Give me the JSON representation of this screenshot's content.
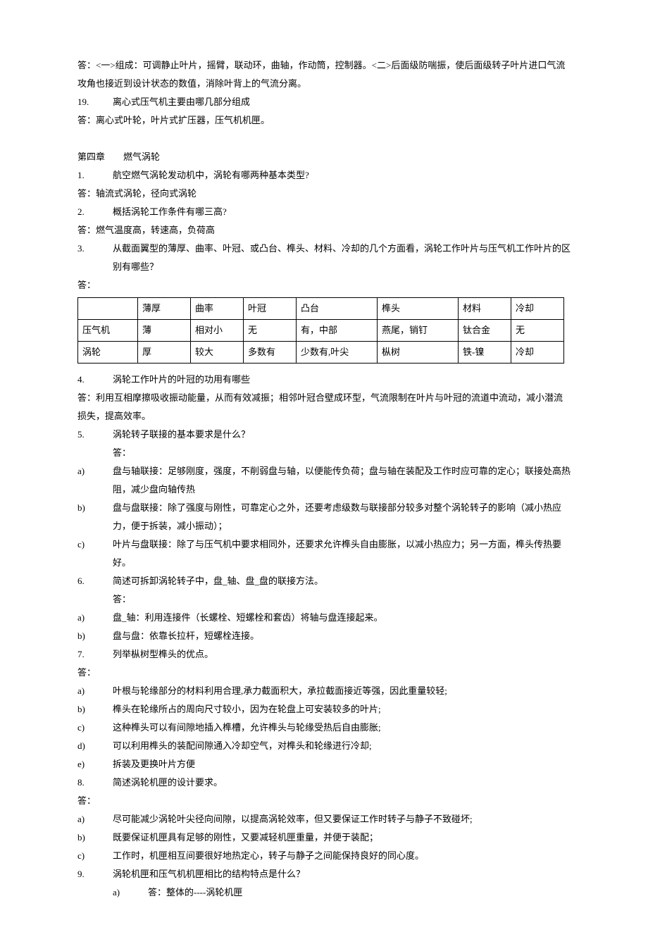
{
  "intro": {
    "p1": "答：<一>组成：可调静止叶片，摇臂，联动环，曲轴，作动筒，控制器。<二>后面级防喘振，使后面级转子叶片进口气流攻角也接近到设计状态的数值，消除叶背上的气流分离。",
    "q19_num": "19.",
    "q19": "离心式压气机主要由哪几部分组成",
    "a19": "答：离心式叶轮，叶片式扩压器，压气机机匣。"
  },
  "chapter": "第四章　　燃气涡轮",
  "q1": {
    "num": "1.",
    "text": "航空燃气涡轮发动机中，涡轮有哪两种基本类型?",
    "ans": "答：轴流式涡轮，径向式涡轮"
  },
  "q2": {
    "num": "2.",
    "text": "概括涡轮工作条件有哪三高?",
    "ans": "答：燃气温度高，转速高，负荷高"
  },
  "q3": {
    "num": "3.",
    "text": "从截面翼型的薄厚、曲率、叶冠、或凸台、榫头、材料、冷却的几个方面看，涡轮工作叶片与压气机工作叶片的区别有哪些？",
    "ans": "答："
  },
  "table": {
    "header": [
      "",
      "薄厚",
      "曲率",
      "叶冠",
      "凸台",
      "榫头",
      "材料",
      "冷却"
    ],
    "row1": [
      "压气机",
      "薄",
      "相对小",
      "无",
      "有，中部",
      "燕尾，销钉",
      "钛合金",
      "无"
    ],
    "row2": [
      "涡轮",
      "厚",
      "较大",
      "多数有",
      "少数有,叶尖",
      "枞树",
      "铁-镍",
      "冷却"
    ]
  },
  "q4": {
    "num": "4.",
    "text": "涡轮工作叶片的叶冠的功用有哪些",
    "ans": "答：利用互相摩擦吸收振动能量，从而有效减振；相邻叶冠合壁成环型，气流限制在叶片与叶冠的流道中流动，减小潜流损失，提高效率。"
  },
  "q5": {
    "num": "5.",
    "text": "涡轮转子联接的基本要求是什么？",
    "ans_label": "答：",
    "a": {
      "label": "a)",
      "text": "盘与轴联接：足够刚度，强度，不削弱盘与轴，以便能传负荷；盘与轴在装配及工作时应可靠的定心；联接处高热阻，减少盘向轴传热"
    },
    "b": {
      "label": "b)",
      "text": "盘与盘联接：除了强度与刚性，可靠定心之外，还要考虑级数与联接部分较多对整个涡轮转子的影响（减小热应力，便于拆装，减小振动）；"
    },
    "c": {
      "label": "c)",
      "text": "叶片与盘联接：除了与压气机中要求相同外，还要求允许榫头自由膨胀，以减小热应力；另一方面，榫头传热要好。"
    }
  },
  "q6": {
    "num": "6.",
    "text": "简述可拆卸涡轮转子中，盘_轴、盘_盘的联接方法。",
    "ans_label": "答：",
    "a": {
      "label": "a)",
      "text": "盘_轴：利用连接件（长螺栓、短螺栓和套齿）将轴与盘连接起来。"
    },
    "b": {
      "label": "b)",
      "text": "盘与盘：依靠长拉杆，短螺栓连接。"
    }
  },
  "q7": {
    "num": "7.",
    "text": "列举枞树型榫头的优点。",
    "ans_label": "答：",
    "a": {
      "label": "a)",
      "text": "叶根与轮缘部分的材料利用合理,承力截面积大，承拉截面接近等强，因此重量较轻;"
    },
    "b": {
      "label": "b)",
      "text": "榫头在轮缘所占的周向尺寸较小，因为在轮盘上可安装较多的叶片;"
    },
    "c": {
      "label": "c)",
      "text": "这种榫头可以有间隙地插入榫槽，允许榫头与轮缘受热后自由膨胀;"
    },
    "d": {
      "label": "d)",
      "text": "可以利用榫头的装配间隙通入冷却空气，对榫头和轮缘进行冷却;"
    },
    "e": {
      "label": "e)",
      "text": "拆装及更换叶片方便"
    }
  },
  "q8": {
    "num": "8.",
    "text": "简述涡轮机匣的设计要求。",
    "ans_label": "答：",
    "a": {
      "label": "a)",
      "text": "尽可能减少涡轮叶尖径向间隙，以提高涡轮效率，但又要保证工作时转子与静子不致碰坏;"
    },
    "b": {
      "label": "b)",
      "text": "既要保证机匣具有足够的刚性，又要减轻机匣重量，并便于装配；"
    },
    "c": {
      "label": "c)",
      "text": "工作时，机匣相互间要很好地热定心，转子与静子之间能保持良好的同心度。"
    }
  },
  "q9": {
    "num": "9.",
    "text": "涡轮机匣和压气机机匣相比的结构特点是什么？",
    "a": {
      "label": "a)",
      "text": "答：整体的----涡轮机匣"
    }
  }
}
